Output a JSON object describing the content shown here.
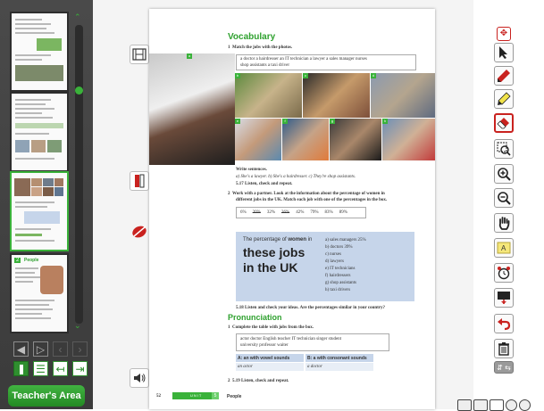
{
  "sidebar": {
    "teachers_area_label": "Teacher's Area",
    "thumb4_label": "People",
    "thumb4_number": "2",
    "nav_prev_glyph": "‹",
    "nav_next_glyph": "›",
    "accent_color": "#3ab23a"
  },
  "page": {
    "vocab_title": "Vocabulary",
    "ex1_num": "1",
    "ex1_instruction": "Match the jobs with the photos.",
    "words_line1": "a doctor   a hairdresser   an IT technician   a lawyer   a sales manager   nurses",
    "words_line2": "shop assistants   a taxi driver",
    "write_sentences": "Write sentences.",
    "examples": "a)  She's a lawyer.    b)  She's a hairdresser.    c)  They're shop assistants.",
    "audio1": "5.17  Listen, check and repeat.",
    "ex2_num": "2",
    "ex2_instruction_line1": "Work with a partner. Look at the information about the percentage of women in",
    "ex2_instruction_line2": "different jobs in the UK. Match each job with one of the percentages in the box.",
    "percentages": [
      "6%",
      "20%",
      "32%",
      "36%",
      "42%",
      "79%",
      "83%",
      "89%"
    ],
    "box_intro_a": "The percentage of ",
    "box_intro_b": "women",
    "box_intro_c": " in",
    "box_heading1": "these jobs",
    "box_heading2": "in the UK",
    "box_list": [
      "a)  sales managers  25%",
      "b)  doctors  39%",
      "c)  nurses",
      "d)  lawyers",
      "e)  IT technicians",
      "f)  hairdressers",
      "g)  shop assistants",
      "h)  taxi drivers"
    ],
    "audio2": "5.18  Listen and check your ideas. Are the percentages similar in your country?",
    "pron_title": "Pronunciation",
    "pron1_num": "1",
    "pron1_instruction": "Complete the table with jobs from the box.",
    "pron_words_line1": "actor   doctor   English teacher   IT technician   singer   student",
    "pron_words_line2": "university professor   waiter",
    "table_head_a": "A: an with vowel sounds",
    "table_head_b": "B: a with consonant sounds",
    "table_cell_a": "an actor",
    "table_cell_b": "a doctor",
    "pron2_num": "2",
    "audio3": "5.19  Listen, check and repeat.",
    "footer_page": "52",
    "footer_unit": "UNIT",
    "footer_unit_num": "5",
    "footer_title": "People",
    "photo_labels": [
      "a",
      "b",
      "c",
      "d",
      "e",
      "f",
      "g",
      "h"
    ]
  }
}
